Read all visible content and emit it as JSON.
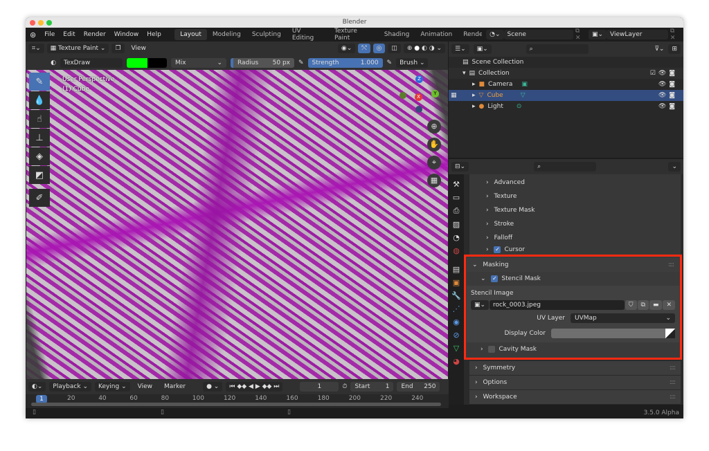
{
  "window_title": "Blender",
  "menu": [
    "File",
    "Edit",
    "Render",
    "Window",
    "Help"
  ],
  "workspaces": [
    "Layout",
    "Modeling",
    "Sculpting",
    "UV Editing",
    "Texture Paint",
    "Shading",
    "Animation",
    "Renderi"
  ],
  "scene": "Scene",
  "view_layer": "ViewLayer",
  "viewport_header": {
    "mode": "Texture Paint",
    "view": "View"
  },
  "tool_settings": {
    "brush": "TexDraw",
    "primary_color": "#00ff00",
    "secondary_color": "#000000",
    "blend": "Mix",
    "radius_label": "Radius",
    "radius": "50 px",
    "strength_label": "Strength",
    "strength": "1.000",
    "brush_menu": "Brush"
  },
  "viewport": {
    "perspective": "User Perspective",
    "object": "(1) Cube",
    "gizmo": {
      "z": "Z",
      "y": "Y",
      "x": "X"
    }
  },
  "outliner": {
    "root": "Scene Collection",
    "collection": "Collection",
    "items": [
      {
        "name": "Camera",
        "selected": false
      },
      {
        "name": "Cube",
        "selected": true
      },
      {
        "name": "Light",
        "selected": false
      }
    ]
  },
  "properties": {
    "closed_panels": [
      "Advanced",
      "Texture",
      "Texture Mask",
      "Stroke",
      "Falloff"
    ],
    "cursor": "Cursor",
    "masking": {
      "title": "Masking",
      "stencil_mask": "Stencil Mask",
      "stencil_image_label": "Stencil Image",
      "stencil_image": "rock_0003.jpeg",
      "uv_layer_label": "UV Layer",
      "uv_layer": "UVMap",
      "display_color_label": "Display Color",
      "display_color": "#6f6f6f",
      "cavity_mask": "Cavity Mask"
    },
    "bottom_panels": [
      "Symmetry",
      "Options",
      "Workspace"
    ],
    "highlight_color": "#ff2a12"
  },
  "timeline": {
    "menus": [
      "Playback",
      "Keying",
      "View",
      "Marker"
    ],
    "current_frame": "1",
    "start_label": "Start",
    "start": "1",
    "end_label": "End",
    "end": "250",
    "ticks": [
      "20",
      "40",
      "60",
      "80",
      "100",
      "120",
      "140",
      "160",
      "180",
      "200",
      "220",
      "240"
    ],
    "playhead": "1"
  },
  "status": {
    "version": "3.5.0 Alpha"
  }
}
